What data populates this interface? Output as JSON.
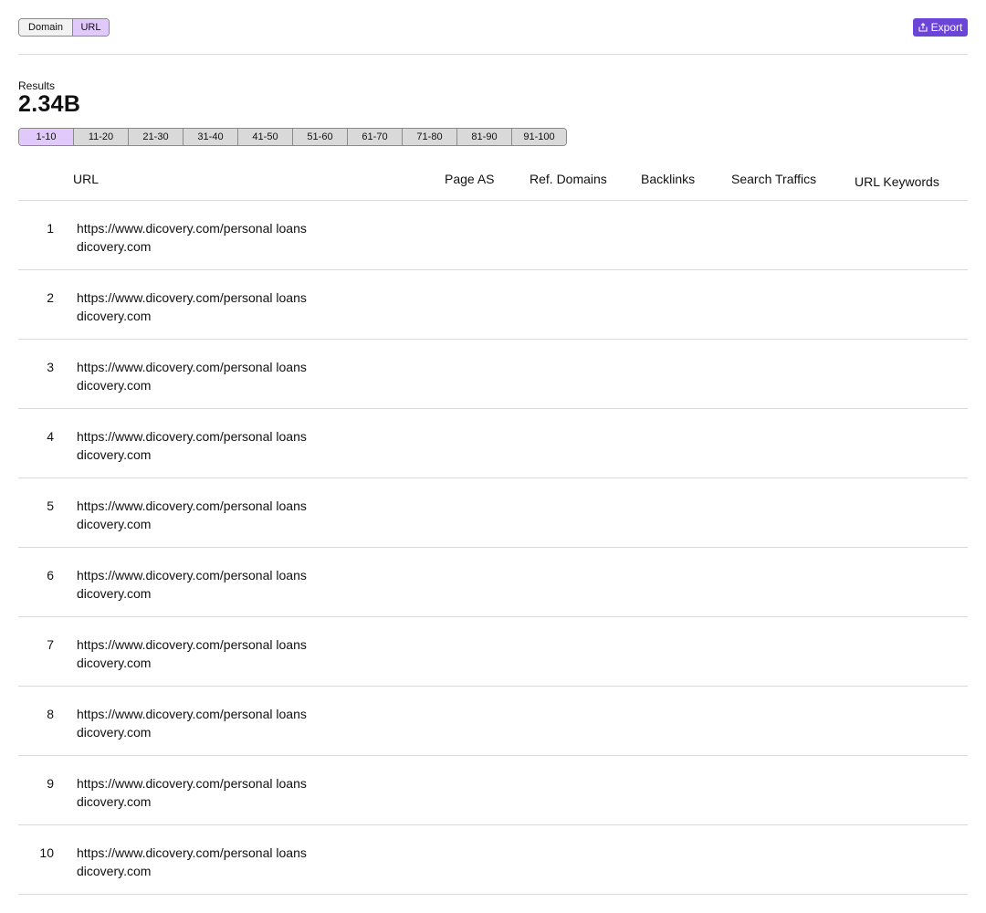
{
  "mode_toggle": {
    "options": [
      "Domain",
      "URL"
    ],
    "selected": "URL"
  },
  "export_button": {
    "label": "Export",
    "icon": "export-icon",
    "color": "#6a45d8"
  },
  "results": {
    "label": "Results",
    "value": "2.34B"
  },
  "pagination": {
    "pages": [
      "1-10",
      "11-20",
      "21-30",
      "31-40",
      "41-50",
      "51-60",
      "61-70",
      "71-80",
      "81-90",
      "91-100"
    ],
    "active": "1-10",
    "active_color": "#e2c9fb"
  },
  "table": {
    "columns": [
      "URL",
      "Page AS",
      "Ref. Domains",
      "Backlinks",
      "Search Traffics",
      "URL Keywords"
    ],
    "rows": [
      {
        "num": "1",
        "url": "https://www.dicovery.com/personal loans",
        "domain": "dicovery.com"
      },
      {
        "num": "2",
        "url": "https://www.dicovery.com/personal loans",
        "domain": "dicovery.com"
      },
      {
        "num": "3",
        "url": "https://www.dicovery.com/personal loans",
        "domain": "dicovery.com"
      },
      {
        "num": "4",
        "url": "https://www.dicovery.com/personal loans",
        "domain": "dicovery.com"
      },
      {
        "num": "5",
        "url": "https://www.dicovery.com/personal loans",
        "domain": "dicovery.com"
      },
      {
        "num": "6",
        "url": "https://www.dicovery.com/personal loans",
        "domain": "dicovery.com"
      },
      {
        "num": "7",
        "url": "https://www.dicovery.com/personal loans",
        "domain": "dicovery.com"
      },
      {
        "num": "8",
        "url": "https://www.dicovery.com/personal loans",
        "domain": "dicovery.com"
      },
      {
        "num": "9",
        "url": "https://www.dicovery.com/personal loans",
        "domain": "dicovery.com"
      },
      {
        "num": "10",
        "url": "https://www.dicovery.com/personal loans",
        "domain": "dicovery.com"
      }
    ]
  }
}
